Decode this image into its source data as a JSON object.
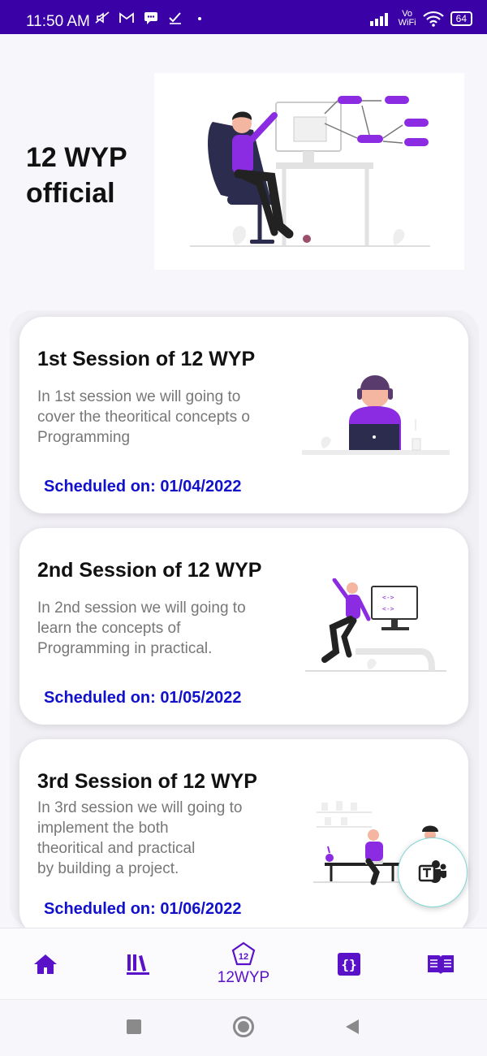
{
  "status_bar": {
    "time": "11:50 AM",
    "left_icons": [
      "mute-icon",
      "gmail-icon",
      "message-icon",
      "checkmark-icon",
      "dot-icon"
    ],
    "right_icons": [
      "signal-icon",
      "vowifi-icon",
      "wifi-icon",
      "battery-icon"
    ],
    "vowifi_label_top": "Vo",
    "vowifi_label_bottom": "WiFi",
    "battery_level": "64"
  },
  "header": {
    "title": "12 WYP official"
  },
  "sessions": [
    {
      "title": "1st Session of 12 WYP",
      "description": "In 1st session we will going to\ncover the theoritical concepts o\nProgramming",
      "date": "Scheduled on: 01/04/2022"
    },
    {
      "title": "2nd Session of 12 WYP",
      "description": "In 2nd session we will going to\n learn the concepts of\nProgramming in practical.",
      "date": "Scheduled on: 01/05/2022"
    },
    {
      "title": "3rd Session of 12 WYP",
      "description": "In 3rd session we will going to\n implement the both\ntheoritical and practical\nby building a project.",
      "date": "Scheduled on: 01/06/2022"
    }
  ],
  "fab": {
    "icon": "teams-icon"
  },
  "bottom_nav": {
    "items": [
      {
        "icon": "home-icon"
      },
      {
        "icon": "library-icon"
      },
      {
        "icon": "badge-12-icon",
        "badge_text": "12",
        "label": "12WYP"
      },
      {
        "icon": "code-braces-icon"
      },
      {
        "icon": "book-icon"
      }
    ]
  },
  "colors": {
    "primary": "#3a01a6",
    "accent": "#5a12c8",
    "illustration_purple": "#8b2be2",
    "date_blue": "#1111cc"
  }
}
